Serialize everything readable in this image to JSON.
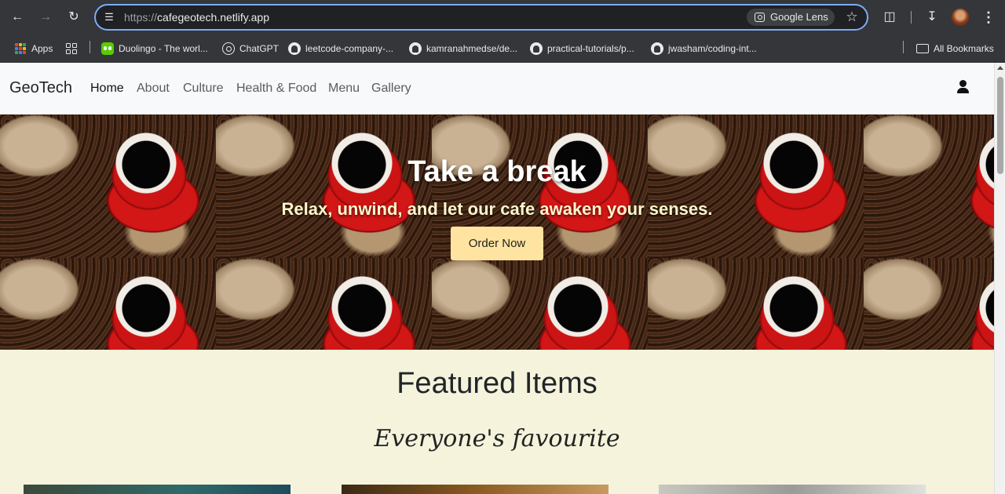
{
  "browser": {
    "url_scheme": "https://",
    "url_host": "cafegeotech.netlify.app",
    "lens_label": "Google Lens",
    "bookmarks": [
      {
        "label": "Apps",
        "icon": "apps-icon"
      },
      {
        "label": "Duolingo - The worl...",
        "icon": "duolingo-icon"
      },
      {
        "label": "ChatGPT",
        "icon": "chatgpt-icon"
      },
      {
        "label": "leetcode-company-...",
        "icon": "github-icon"
      },
      {
        "label": "kamranahmedse/de...",
        "icon": "github-icon"
      },
      {
        "label": "practical-tutorials/p...",
        "icon": "github-icon"
      },
      {
        "label": "jwasham/coding-int...",
        "icon": "github-icon"
      }
    ],
    "all_bookmarks_label": "All Bookmarks"
  },
  "site": {
    "brand": "GeoTech",
    "nav": [
      {
        "label": "Home",
        "active": true
      },
      {
        "label": "About",
        "active": false
      },
      {
        "label": "Culture",
        "active": false
      },
      {
        "label": "Health & Food",
        "active": false
      },
      {
        "label": "Menu",
        "active": false
      },
      {
        "label": "Gallery",
        "active": false
      }
    ],
    "user_icon": "user-icon"
  },
  "hero": {
    "title": "Take a break",
    "subtitle": "Relax, unwind, and let our cafe awaken your senses.",
    "cta_label": "Order Now"
  },
  "featured": {
    "title": "Featured Items",
    "subtitle": "Everyone's favourite"
  },
  "colors": {
    "accent_button": "#ffe3a0",
    "page_background": "#f5f3dc",
    "navbar_background": "#f8f9fa"
  }
}
